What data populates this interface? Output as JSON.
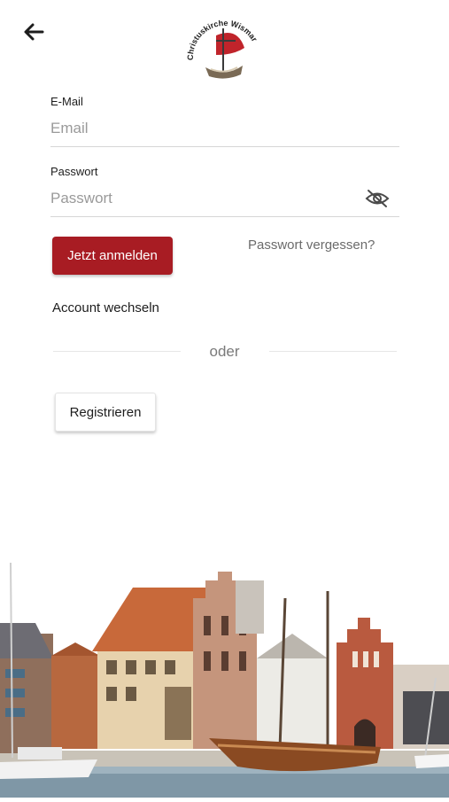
{
  "header": {
    "back_icon": "arrow-left-icon",
    "logo_text": "Christuskirche Wismar"
  },
  "form": {
    "email_label": "E-Mail",
    "email_placeholder": "Email",
    "email_value": "",
    "password_label": "Passwort",
    "password_placeholder": "Passwort",
    "password_value": "",
    "password_visibility_icon": "eye-off-icon"
  },
  "actions": {
    "login_label": "Jetzt anmelden",
    "forgot_label": "Passwort vergessen?",
    "switch_account_label": "Account wechseln",
    "divider_label": "oder",
    "register_label": "Registrieren"
  },
  "colors": {
    "primary": "#a81c23",
    "background": "#ffffff",
    "muted_text": "#7a7a7a"
  },
  "footer": {
    "illustration": "wismar-harbor-photo"
  }
}
